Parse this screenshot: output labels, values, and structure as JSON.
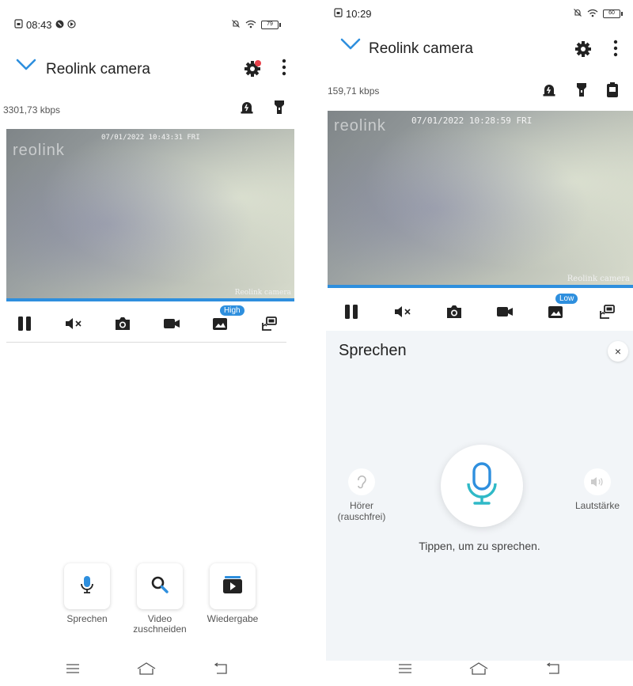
{
  "colors": {
    "accent": "#2e8fde",
    "icon": "#222222",
    "notify_dot": "#e8404a",
    "talk_bg": "#f2f5f8"
  },
  "left": {
    "status": {
      "time": "08:43",
      "battery": "79"
    },
    "header": {
      "title": "Reolink camera"
    },
    "bitrate": "3301,73 kbps",
    "video": {
      "brand": "reolink",
      "timestamp": "07/01/2022 10:43:31 FRI",
      "camera_label": "Reolink camera"
    },
    "quality_badge": "High",
    "actions": [
      {
        "label": "Sprechen",
        "icon": "microphone-icon"
      },
      {
        "label": "Video\nzuschneiden",
        "icon": "magnifier-icon"
      },
      {
        "label": "Wiedergabe",
        "icon": "playback-icon"
      }
    ]
  },
  "right": {
    "status": {
      "time": "10:29",
      "battery": "60"
    },
    "header": {
      "title": "Reolink camera"
    },
    "bitrate": "159,71 kbps",
    "video": {
      "brand": "reolink",
      "timestamp": "07/01/2022 10:28:59 FRI",
      "camera_label": "Reolink camera"
    },
    "quality_badge": "Low",
    "talk": {
      "title": "Sprechen",
      "close": "×",
      "earpiece_label": "Hörer\n(rauschfrei)",
      "volume_label": "Lautstärke",
      "hint": "Tippen, um zu sprechen."
    }
  }
}
